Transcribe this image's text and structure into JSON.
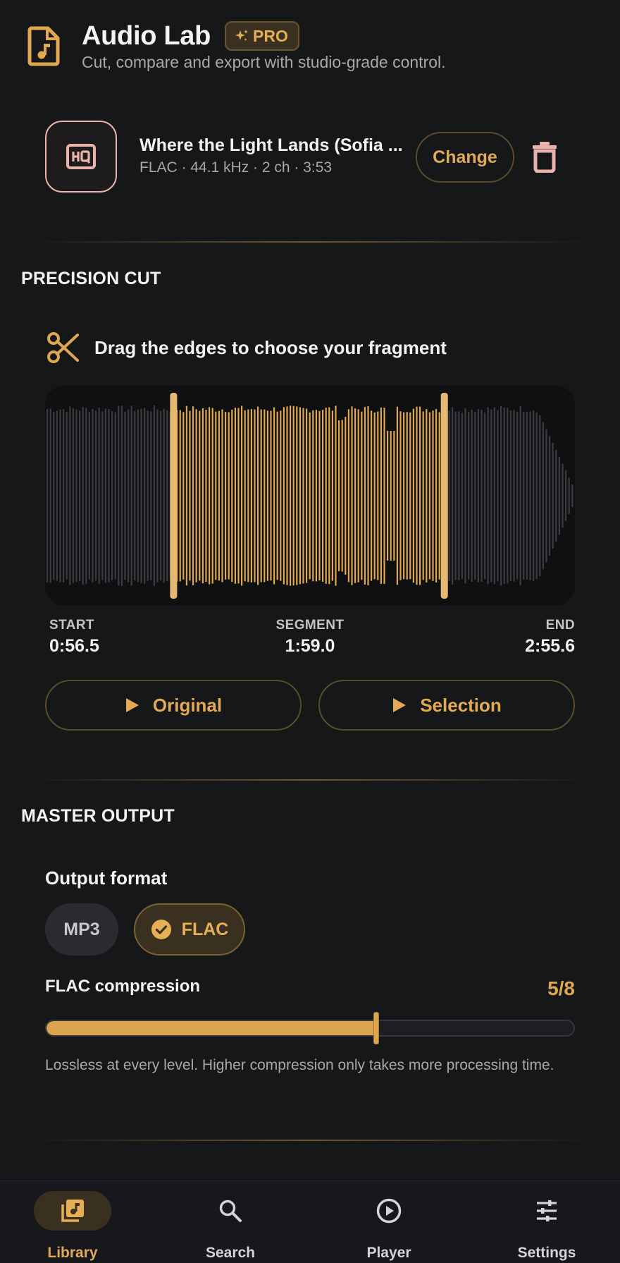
{
  "app": {
    "title": "Audio Lab",
    "badge": "PRO",
    "subtitle": "Cut, compare and export with studio-grade control."
  },
  "track": {
    "title": "Where the Light Lands (Sofia ...",
    "meta": "FLAC · 44.1 kHz · 2 ch · 3:53",
    "change_label": "Change",
    "icons": {
      "art": "hq-icon",
      "delete": "trash-icon"
    }
  },
  "cut": {
    "section_title": "PRECISION CUT",
    "hint": "Drag the edges to choose your fragment",
    "total_seconds": 233,
    "selection_start_seconds": 56.5,
    "selection_end_seconds": 175.6,
    "start_label": "START",
    "start_value": "0:56.5",
    "segment_label": "SEGMENT",
    "segment_value": "1:59.0",
    "end_label": "END",
    "end_value": "2:55.6",
    "play_original": "Original",
    "play_selection": "Selection"
  },
  "output": {
    "section_title": "MASTER OUTPUT",
    "format_title": "Output format",
    "formats": [
      "MP3",
      "FLAC"
    ],
    "selected_format": "FLAC",
    "compression_title": "FLAC compression",
    "compression_value": "5/8",
    "compression_level": 5,
    "compression_max": 8,
    "note": "Lossless at every level. Higher compression only takes more processing time."
  },
  "nav": {
    "items": [
      {
        "label": "Library",
        "icon": "library-music-icon",
        "active": true
      },
      {
        "label": "Search",
        "icon": "search-icon",
        "active": false
      },
      {
        "label": "Player",
        "icon": "play-circle-icon",
        "active": false
      },
      {
        "label": "Settings",
        "icon": "tune-icon",
        "active": false
      }
    ]
  },
  "colors": {
    "accent": "#dfa74f",
    "background": "#161719",
    "waveform_inactive": "#4a4b4f",
    "track_art_border": "#e9b3ab"
  }
}
